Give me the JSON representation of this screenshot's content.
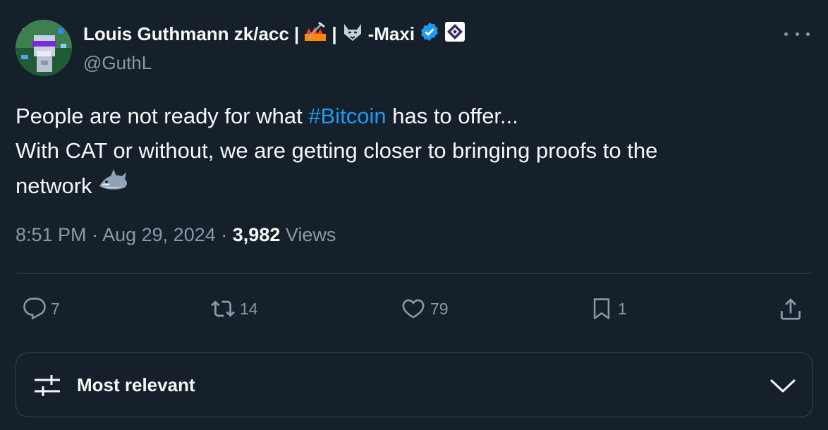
{
  "author": {
    "display_name": "Louis Guthmann zk/acc |",
    "separator": "|",
    "name_suffix": "-Maxi",
    "handle": "@GuthL",
    "verified": true
  },
  "tweet": {
    "text_before_hashtag": "People are not ready for what ",
    "hashtag": "#Bitcoin",
    "text_after_hashtag": " has to offer...",
    "line2": "With CAT or without, we are getting closer to bringing proofs to the",
    "line3": "network"
  },
  "meta": {
    "time": "8:51 PM",
    "dot1": "·",
    "date": "Aug 29, 2024",
    "dot2": "·",
    "views_count": "3,982",
    "views_label": "Views"
  },
  "actions": {
    "replies": "7",
    "reposts": "14",
    "likes": "79",
    "bookmarks": "1"
  },
  "sort": {
    "label": "Most relevant"
  },
  "colors": {
    "background": "#15202b",
    "accent": "#1d9bf0",
    "muted": "#8b98a5",
    "divider": "#38444d"
  },
  "icons": [
    "more-icon",
    "verified-badge-icon",
    "reply-icon",
    "repost-icon",
    "like-icon",
    "bookmark-icon",
    "share-icon",
    "sort-sliders-icon",
    "chevron-down-icon",
    "shark-emoji-icon",
    "pickaxe-fire-emoji-icon",
    "wolf-emoji-icon",
    "affiliate-badge-icon"
  ]
}
